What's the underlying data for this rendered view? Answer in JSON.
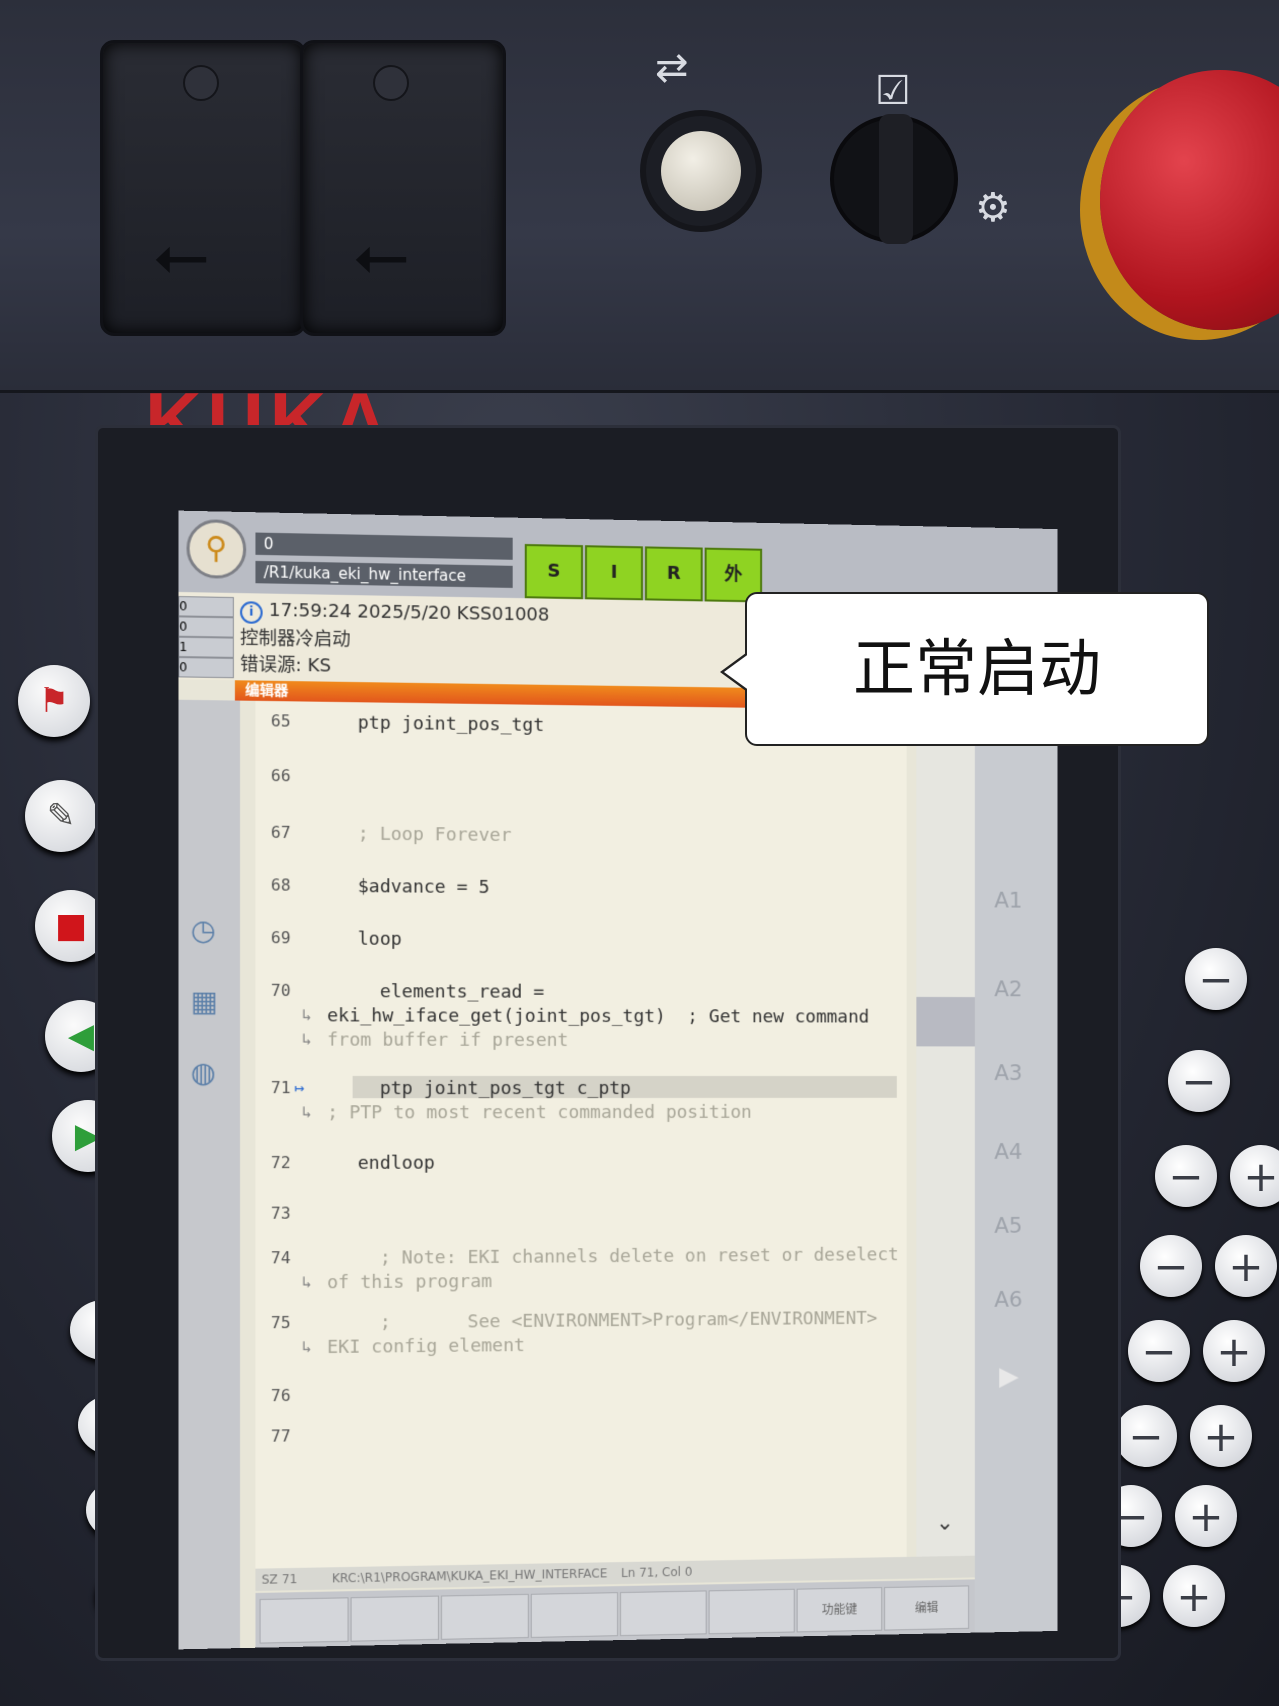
{
  "brand": {
    "logo": "KUKA"
  },
  "hardware": {
    "usb_icons": [
      "usb-icon",
      "usb-icon"
    ],
    "connect_icon": "plug-icon",
    "keyswitch_icon": "checklist-icon",
    "settings_icon": "gear-icon"
  },
  "topbar": {
    "override_value": "0",
    "program_path": "/R1/kuka_eki_hw_interface",
    "status_buttons": [
      "S",
      "I",
      "R",
      "外"
    ]
  },
  "messages": {
    "counts": [
      "0",
      "0",
      "1",
      "0"
    ],
    "timestamp": "17:59:24 2025/5/20 KSS01008",
    "line2": "控制器冷启动",
    "line3": "错误源: KS"
  },
  "editor": {
    "title": "编辑器",
    "lines": [
      {
        "num": "65",
        "text": "ptp joint_pos_tgt"
      },
      {
        "num": "66",
        "text": ""
      },
      {
        "num": "67",
        "text": "; Loop Forever"
      },
      {
        "num": "68",
        "text": "$advance = 5"
      },
      {
        "num": "69",
        "text": "loop"
      },
      {
        "num": "70",
        "text": "  elements_read =",
        "cont1": "eki_hw_iface_get(joint_pos_tgt)  ; Get new command",
        "cont2": "from buffer if present"
      },
      {
        "num": "71",
        "text": "  ptp joint_pos_tgt c_ptp",
        "cont1": "; PTP to most recent commanded position"
      },
      {
        "num": "72",
        "text": "endloop"
      },
      {
        "num": "73",
        "text": ""
      },
      {
        "num": "74",
        "text": "  ; Note: EKI channels delete on reset or deselect",
        "cont1": "of this program"
      },
      {
        "num": "75",
        "text": "  ;       See <ENVIRONMENT>Program</ENVIRONMENT>",
        "cont1": "EKI config element"
      },
      {
        "num": "76",
        "text": ""
      },
      {
        "num": "77",
        "text": ""
      }
    ]
  },
  "statusline": {
    "left": "SZ 71",
    "path": "KRC:\\R1\\PROGRAM\\KUKA_EKI_HW_INTERFACE",
    "pos": "Ln 71, Col 0"
  },
  "softkeys": [
    "",
    "",
    "",
    "",
    "",
    "",
    "功能键",
    "编辑"
  ],
  "axes": [
    "A1",
    "A2",
    "A3",
    "A4",
    "A5",
    "A6"
  ],
  "callout": {
    "text": "正常启动"
  },
  "colors": {
    "status_green": "#8fd322",
    "editor_orange": "#e2561c",
    "kuka_red": "#c8262a"
  }
}
